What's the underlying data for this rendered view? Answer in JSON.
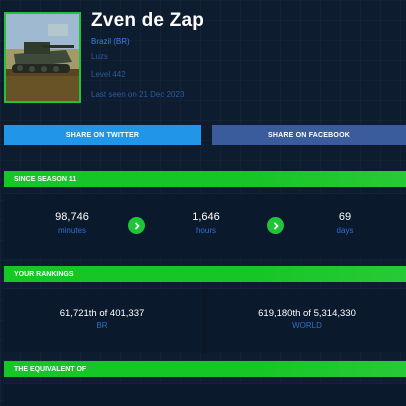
{
  "profile": {
    "name": "Zven de Zap",
    "country": "Brazil (BR)",
    "realm": "Luzs",
    "level": "Level 442",
    "last_seen": "Last seen on 21 Dec 2023"
  },
  "share": {
    "twitter_label": "SHARE ON TWITTER",
    "facebook_label": "SHARE ON FACEBOOK"
  },
  "since_season": {
    "header": "SINCE SEASON 11",
    "minutes_value": "98,746",
    "minutes_unit": "minutes",
    "hours_value": "1,646",
    "hours_unit": "hours",
    "days_value": "69",
    "days_unit": "days"
  },
  "rankings": {
    "header": "YOUR RANKINGS",
    "country_rank": "61,721th of 401,337",
    "country_label": "BR",
    "world_rank": "619,180th of 5,314,330",
    "world_label": "WORLD"
  },
  "equivalent": {
    "header": "THE EQUIVALENT OF"
  },
  "colors": {
    "accent_green": "#16c526",
    "twitter_blue": "#2196e8",
    "facebook_blue": "#3b5c9c",
    "label_blue": "#2f6fcf",
    "background": "#0e1c30"
  },
  "icons": {
    "next": "chevron-right-icon"
  }
}
